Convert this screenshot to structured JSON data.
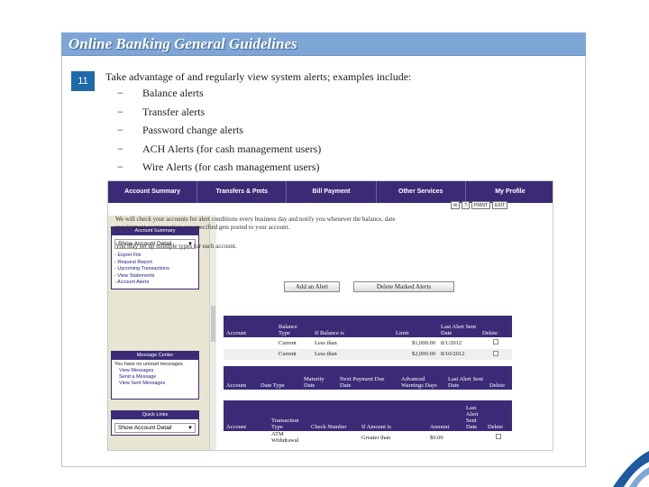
{
  "slide": {
    "title": "Online Banking General Guidelines",
    "number": "11",
    "intro": "Take advantage of and regularly view system alerts; examples include:",
    "bullets": [
      "Balance alerts",
      "Transfer alerts",
      "Password change alerts",
      "ACH Alerts (for cash management users)",
      "Wire Alerts (for cash management users)"
    ],
    "bullet_marker": "−"
  },
  "app": {
    "nav": [
      "Account Summary",
      "Transfers & Pmts",
      "Bill Payment",
      "Other Services",
      "My Profile"
    ],
    "toolbar": {
      "print": "PRINT",
      "exit": "EXIT"
    },
    "account_box": {
      "title": "Account Summary",
      "select": "Show Account Detail",
      "links": [
        "- Export File",
        "- Request Report",
        "- Upcoming Transactions",
        "- View Statements",
        "- Account Alerts"
      ]
    },
    "message_box": {
      "title": "Message Center",
      "text": "You have no unread messages.",
      "links": [
        "View Messages",
        "Send a Message",
        "View Sent Messages"
      ]
    },
    "quick_box": {
      "title": "Quick Links",
      "select": "Show Account Detail"
    },
    "notice": "We will check your accounts for alert conditions every business day and notify you whenever the balance, date requirement or transaction you specified gets posted to your account.",
    "notice2": "You may set up multiple types for each account.",
    "add_button": "Add an Alert",
    "delete_button": "Delete Marked Alerts",
    "table1": {
      "headers": [
        "Account",
        "Balance Type",
        "If Balance is",
        "Limit",
        "Last Alert Sent Date",
        "Delete"
      ],
      "rows": [
        [
          "",
          "Current",
          "Less than",
          "$1,000.00",
          "8/1/2012"
        ],
        [
          "",
          "Current",
          "Less than",
          "$2,000.00",
          "8/10/2012"
        ]
      ]
    },
    "table2": {
      "headers": [
        "Account",
        "Date Type",
        "Maturity Date",
        "Next Payment Due Date",
        "Advanced Warnings Days",
        "Last Alert Sent Date",
        "Delete"
      ]
    },
    "table3": {
      "headers": [
        "Account",
        "Transaction Type",
        "Check Number",
        "If Amount is",
        "Amount",
        "Last Alert Sent Date",
        "Delete"
      ],
      "rows": [
        [
          "",
          "ATM Withdrawal",
          "",
          "Greater than",
          "$0.00",
          ""
        ]
      ]
    }
  }
}
